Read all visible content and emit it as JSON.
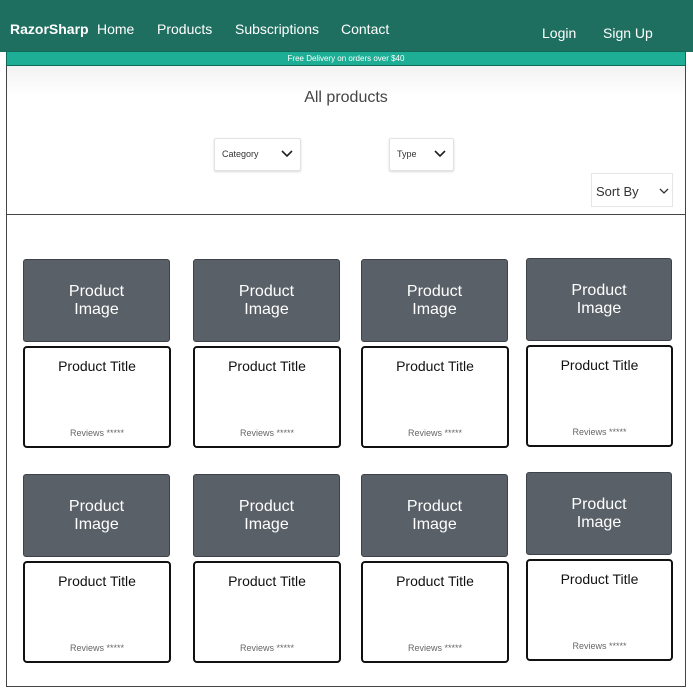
{
  "nav": {
    "brand": "RazorSharp",
    "links": [
      "Home",
      "Products",
      "Subscriptions",
      "Contact"
    ],
    "login": "Login",
    "signup": "Sign Up"
  },
  "banner": "Free Delivery on orders over $40",
  "filters": {
    "title": "All products",
    "category": "Category",
    "type": "Type",
    "sort": "Sort By"
  },
  "products": [
    {
      "image": "Product Image",
      "title": "Product Title",
      "reviews": "Reviews *****"
    },
    {
      "image": "Product Image",
      "title": "Product Title",
      "reviews": "Reviews *****"
    },
    {
      "image": "Product Image",
      "title": "Product Title",
      "reviews": "Reviews *****"
    },
    {
      "image": "Product Image",
      "title": "Product Title",
      "reviews": "Reviews *****"
    },
    {
      "image": "Product Image",
      "title": "Product Title",
      "reviews": "Reviews *****"
    },
    {
      "image": "Product Image",
      "title": "Product Title",
      "reviews": "Reviews *****"
    },
    {
      "image": "Product Image",
      "title": "Product Title",
      "reviews": "Reviews *****"
    },
    {
      "image": "Product Image",
      "title": "Product Title",
      "reviews": "Reviews *****"
    }
  ],
  "colors": {
    "nav_bg": "#1f6f60",
    "banner_bg": "#1dae95",
    "image_placeholder": "#596067"
  }
}
